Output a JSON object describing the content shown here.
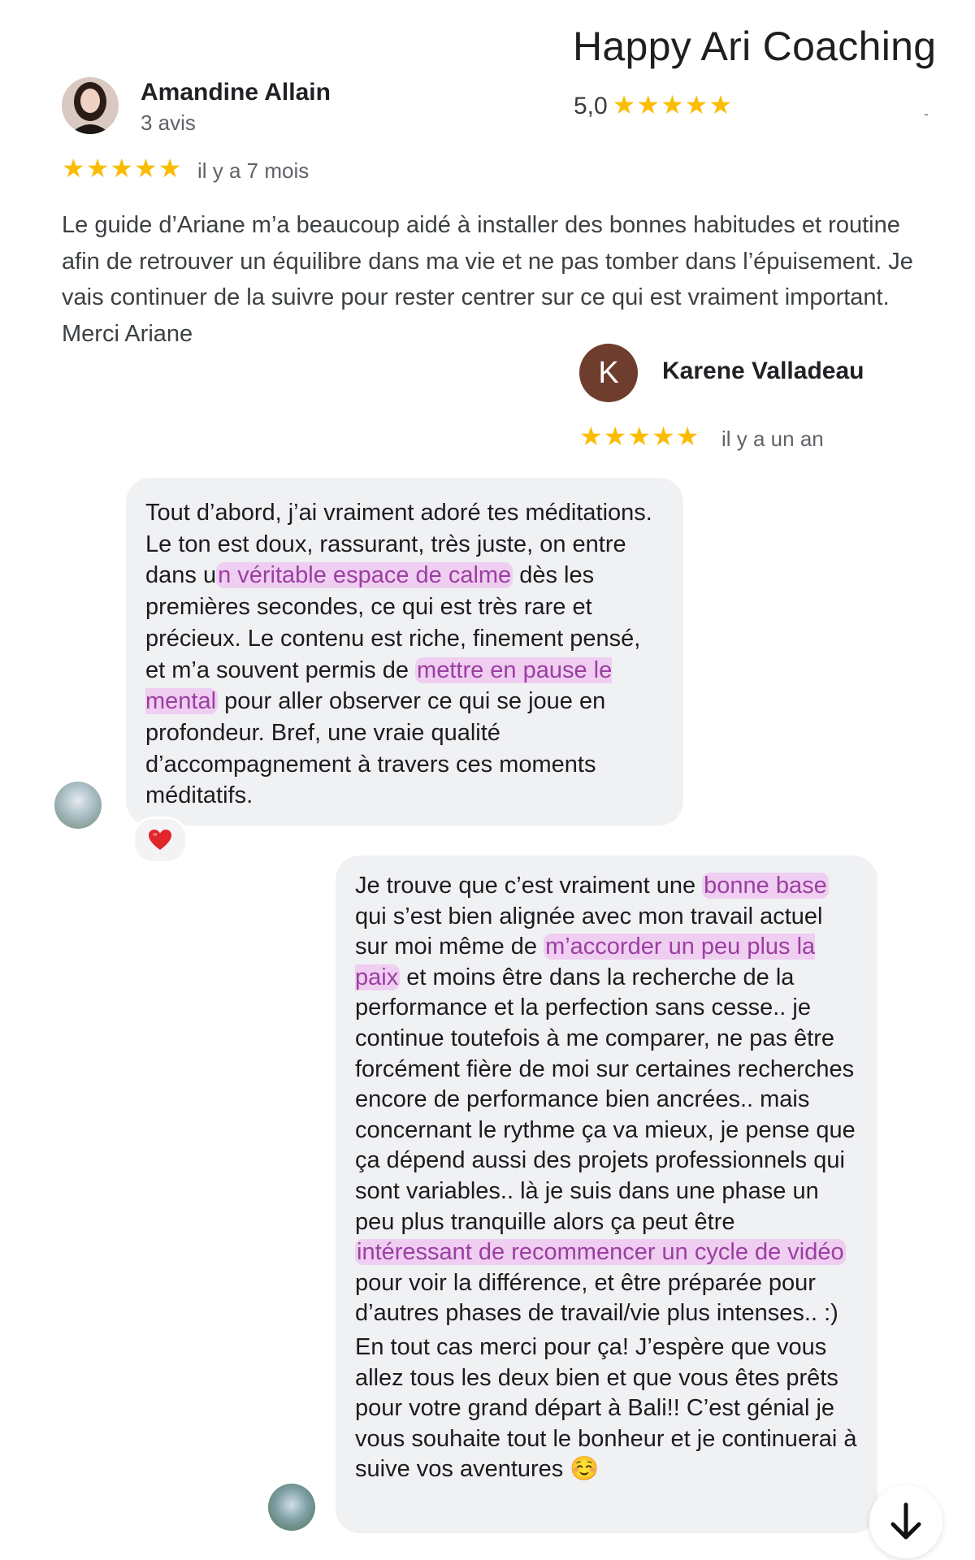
{
  "business": {
    "name": "Happy Ari Coaching",
    "rating": "5,0",
    "stars": "★★★★★",
    "dash": "-"
  },
  "review1": {
    "author": "Amandine Allain",
    "count": "3 avis",
    "stars": "★★★★★",
    "time": "il y a 7 mois",
    "text": "Le guide d’Ariane m’a beaucoup aidé à installer des bonnes habitudes et routine afin de retrouver un équilibre dans ma vie et ne pas tomber dans l’épuisement. Je vais continuer de la suivre pour rester centrer sur ce qui est vraiment important.",
    "text2": "Merci Ariane"
  },
  "review2": {
    "initial": "K",
    "author": "Karene Valladeau",
    "stars": "★★★★★",
    "time": "il y a un an"
  },
  "chat": {
    "m1": {
      "t1": "Tout d’abord, j’ai vraiment adoré tes méditations. Le ton est doux, rassurant, très juste, on entre dans u",
      "h1": "n véritable espace de calme",
      "t2": " dès les premières secondes, ce qui est très rare et précieux. Le contenu est riche, finement pensé, et m’a souvent permis de ",
      "h2": "mettre en pause le mental",
      "t3": " pour aller observer ce qui se joue en profondeur. Bref, une vraie qualité d’accompagnement à travers ces moments méditatifs."
    },
    "reaction": "heart",
    "m2": {
      "t1": "Je trouve que c’est vraiment une ",
      "h1": "bonne base",
      "t2": " qui s’est bien alignée avec mon travail actuel sur moi même de ",
      "h2": "m’accorder un peu plus la paix",
      "t3": " et moins être dans la recherche de la performance et la perfection sans cesse.. je continue toutefois à me comparer, ne pas être forcément fière de moi sur certaines recherches encore de performance bien ancrées.. mais concernant le rythme ça va mieux, je pense que ça dépend aussi des projets professionnels qui sont variables.. là je suis dans une phase un peu plus tranquille alors ça peut être ",
      "h3": "intéressant de recommencer un cycle de vidéo",
      "t4": " pour voir la différence, et être préparée pour d’autres phases de travail/vie plus intenses.. :)",
      "p2": "En tout cas merci pour ça! J’espère que vous allez tous les deux bien et que vous êtes prêts pour votre grand départ à Bali!! C’est génial je vous souhaite tout le bonheur et je continuerai à suive vos aventures ☺️"
    }
  },
  "colors": {
    "star": "#fbbc04",
    "highlight": "#ee8cee",
    "bubble": "#f0f1f3",
    "avatar_k": "#6e3d2d"
  }
}
